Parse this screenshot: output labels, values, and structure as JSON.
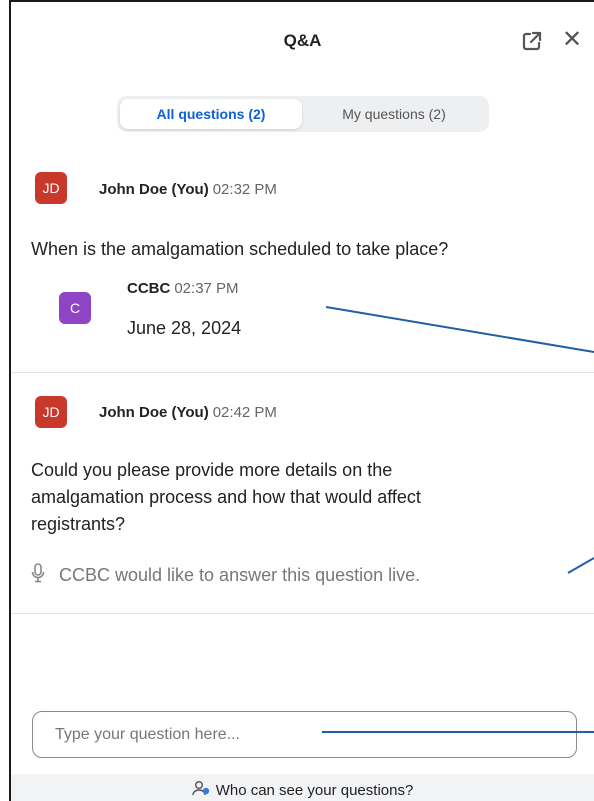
{
  "header": {
    "title": "Q&A",
    "popout_icon": "popout-icon",
    "close_glyph": "✕"
  },
  "tabs": [
    {
      "label": "All questions (2)",
      "active": true
    },
    {
      "label": "My questions (2)",
      "active": false
    }
  ],
  "questions": [
    {
      "avatar": "JD",
      "avatar_color": "#c8392b",
      "author": "John Doe (You)",
      "time": "02:32 PM",
      "text": "When is the amalgamation scheduled to take place?",
      "reply": {
        "avatar": "C",
        "avatar_color": "#8e44c4",
        "author": "CCBC",
        "time": "02:37 PM",
        "text": "June 28, 2024"
      }
    },
    {
      "avatar": "JD",
      "avatar_color": "#c8392b",
      "author": "John Doe (You)",
      "time": "02:42 PM",
      "text_lines": [
        "Could you please provide more details on the",
        "amalgamation process and how that would affect",
        "registrants?"
      ],
      "live_answer": "CCBC would like to answer this question live."
    }
  ],
  "input": {
    "placeholder": "Type your question here..."
  },
  "footer": {
    "link": "Who can see your questions?"
  },
  "colors": {
    "accent": "#0e5fd8",
    "annotation_line": "#1f5fa6"
  }
}
